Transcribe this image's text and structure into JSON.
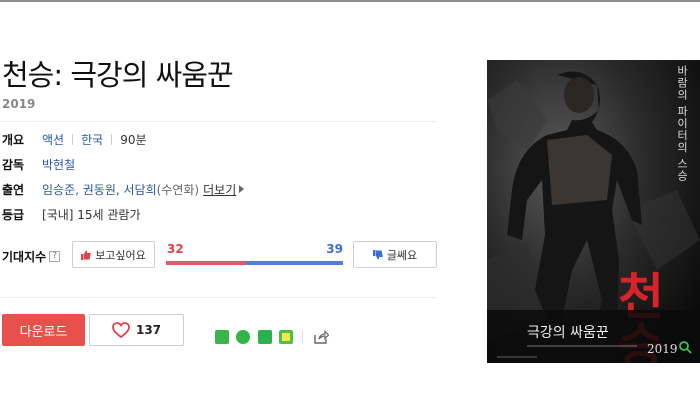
{
  "movie": {
    "title": "천승: 극강의 싸움꾼",
    "year": "2019"
  },
  "info": {
    "overview_label": "개요",
    "genre": "액션",
    "country": "한국",
    "runtime": "90분",
    "director_label": "감독",
    "director": "박현철",
    "cast_label": "출연",
    "cast": "임승준, 권동원, 서담희",
    "cast_note": "(수연화)",
    "more_label": "더보기",
    "rating_label": "등급",
    "rating": "[국내] 15세 관람가"
  },
  "expect": {
    "label": "기대지수",
    "help": "?",
    "want_label": "보고싶어요",
    "no_label": "글쎄요",
    "want_count": "32",
    "no_count": "39",
    "want_fraction": 0.45
  },
  "actions": {
    "download_label": "다운로드",
    "like_count": "137"
  },
  "poster": {
    "tagline": "바람의 파이터의 스승",
    "big_title": "천승",
    "subtitle": "극강의 싸움꾼",
    "year": "2019"
  },
  "colors": {
    "red": "#e8514b",
    "blue": "#3c6fd4",
    "link": "#2b57a6"
  }
}
